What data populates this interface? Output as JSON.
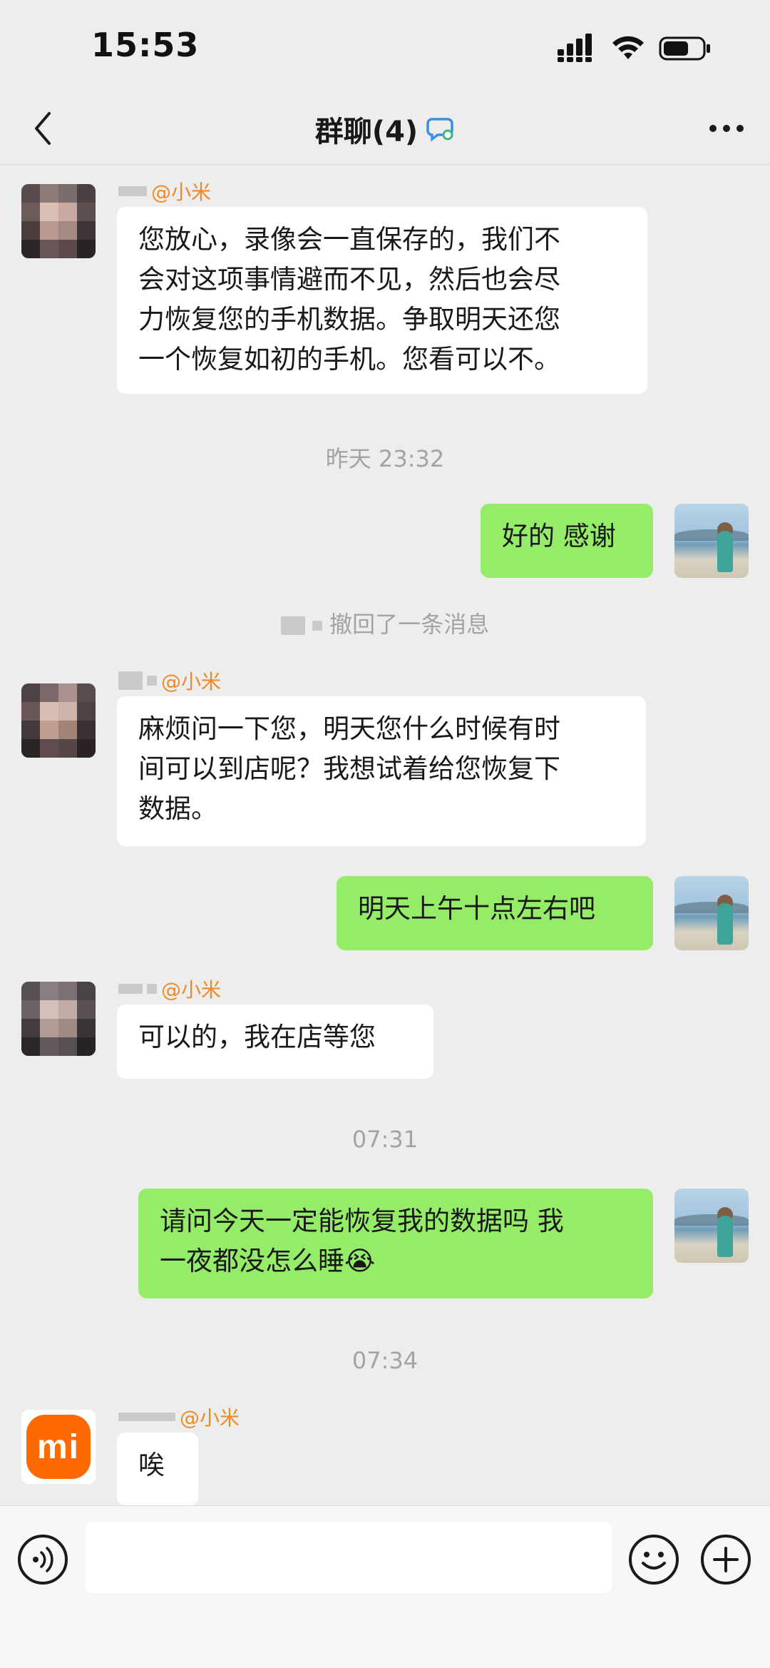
{
  "status_bar": {
    "time": "15:53"
  },
  "header": {
    "title": "群聊(4)",
    "back_icon": "chevron-left-icon",
    "more_icon": "more-dots-icon"
  },
  "messages": [
    {
      "type": "received",
      "sender": "@小米",
      "lines": [
        "您放心，录像会一直保存的，我们不",
        "会对这项事情避而不见，然后也会尽",
        "力恢复您的手机数据。争取明天还您",
        "一个恢复如初的手机。您看可以不。"
      ]
    },
    {
      "type": "time",
      "text": "昨天 23:32"
    },
    {
      "type": "sent",
      "lines": [
        "好的 感谢"
      ]
    },
    {
      "type": "system",
      "text": "撤回了一条消息"
    },
    {
      "type": "received",
      "sender": "@小米",
      "lines": [
        "麻烦问一下您，明天您什么时候有时",
        "间可以到店呢？我想试着给您恢复下",
        "数据。"
      ]
    },
    {
      "type": "sent",
      "lines": [
        "明天上午十点左右吧"
      ]
    },
    {
      "type": "received",
      "sender": "@小米",
      "lines": [
        "可以的，我在店等您"
      ]
    },
    {
      "type": "time",
      "text": "07:31"
    },
    {
      "type": "sent",
      "lines": [
        "请问今天一定能恢复我的数据吗  我",
        "一夜都没怎么睡😭"
      ]
    },
    {
      "type": "time",
      "text": "07:34"
    },
    {
      "type": "received",
      "sender": "@小米",
      "lines": [
        "唉"
      ]
    }
  ],
  "logo_text": "mi",
  "input_bar": {
    "placeholder": "",
    "voice_icon": "voice-icon",
    "emoji_icon": "emoji-icon",
    "plus_icon": "plus-icon"
  },
  "colors": {
    "background": "#ededed",
    "sent_bubble": "#95ec69",
    "received_bubble": "#ffffff",
    "sender_name": "#f08a24",
    "timestamp": "#a3a3a3"
  }
}
